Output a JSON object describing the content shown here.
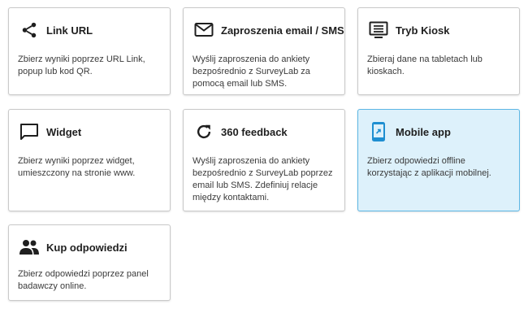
{
  "cards": [
    {
      "icon": "share-icon",
      "title": "Link URL",
      "desc_lines": [
        "Zbierz wyniki poprzez URL Link,",
        "popup lub kod QR."
      ]
    },
    {
      "icon": "mail-icon",
      "title": "Zaproszenia email / SMS",
      "desc_lines": [
        "Wyślij zaproszenia do ankiety",
        "bezpośrednio z SurveyLab za",
        "pomocą email lub SMS."
      ]
    },
    {
      "icon": "kiosk-icon",
      "title": "Tryb Kiosk",
      "desc_lines": [
        "Zbieraj dane na tabletach lub",
        "kioskach."
      ]
    },
    {
      "icon": "chat-bubble-icon",
      "title": "Widget",
      "desc_lines": [
        "Zbierz wyniki poprzez widget,",
        "umieszczony na stronie www."
      ]
    },
    {
      "icon": "refresh-icon",
      "title": "360 feedback",
      "desc_lines": [
        "Wyślij zaproszenia do ankiety",
        "bezpośrednio z SurveyLab poprzez",
        "email lub SMS. Zdefiniuj relacje",
        "między kontaktami."
      ]
    },
    {
      "icon": "mobile-app-icon",
      "title": "Mobile app",
      "desc_lines": [
        "Zbierz odpowiedzi offline",
        "korzystając z aplikacji mobilnej."
      ]
    },
    {
      "icon": "people-icon",
      "title": "Kup odpowiedzi",
      "desc_lines": [
        "Zbierz odpowiedzi poprzez panel",
        "badawczy online."
      ]
    }
  ],
  "colors": {
    "selected_background": "#ddf1fb",
    "selected_border": "#5db7e5",
    "accent_icon": "#1f8fd1"
  }
}
